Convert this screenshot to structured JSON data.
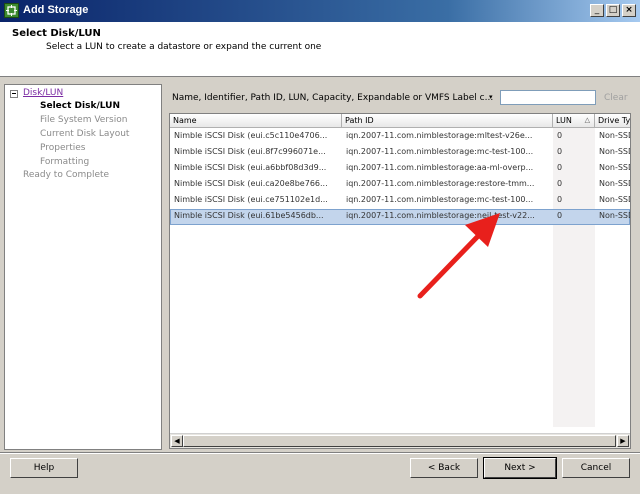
{
  "window": {
    "title": "Add Storage",
    "controls": {
      "minimize": "_",
      "maximize": "□",
      "close": "×"
    }
  },
  "header": {
    "title": "Select Disk/LUN",
    "subtitle": "Select a LUN to create a datastore or expand the current one"
  },
  "nav": {
    "root": "Disk/LUN",
    "items": [
      {
        "label": "Select Disk/LUN"
      },
      {
        "label": "File System Version"
      },
      {
        "label": "Current Disk Layout"
      },
      {
        "label": "Properties"
      },
      {
        "label": "Formatting"
      }
    ],
    "final": "Ready to Complete"
  },
  "filter": {
    "label": "Name, Identifier, Path ID, LUN, Capacity, Expandable or VMFS Label c...",
    "dropdown_arrow": "▾",
    "value": "",
    "clear_label": "Clear"
  },
  "table": {
    "columns": [
      "Name",
      "Path ID",
      "LUN",
      "Drive Ty"
    ],
    "sort_indicator": "△",
    "rows": [
      {
        "name": "Nimble iSCSI Disk (eui.c5c110e4706...",
        "path": "iqn.2007-11.com.nimblestorage:mltest-v26e...",
        "lun": "0",
        "drive": "Non-SSD"
      },
      {
        "name": "Nimble iSCSI Disk (eui.8f7c996071e...",
        "path": "iqn.2007-11.com.nimblestorage:mc-test-100...",
        "lun": "0",
        "drive": "Non-SSD"
      },
      {
        "name": "Nimble iSCSI Disk (eui.a6bbf08d3d9...",
        "path": "iqn.2007-11.com.nimblestorage:aa-ml-overp...",
        "lun": "0",
        "drive": "Non-SSD"
      },
      {
        "name": "Nimble iSCSI Disk (eui.ca20e8be766...",
        "path": "iqn.2007-11.com.nimblestorage:restore-tmm...",
        "lun": "0",
        "drive": "Non-SSD"
      },
      {
        "name": "Nimble iSCSI Disk (eui.ce751102e1d...",
        "path": "iqn.2007-11.com.nimblestorage:mc-test-100...",
        "lun": "0",
        "drive": "Non-SSD"
      },
      {
        "name": "Nimble iSCSI Disk (eui.61be5456db...",
        "path": "iqn.2007-11.com.nimblestorage:neil-test-v22...",
        "lun": "0",
        "drive": "Non-SSD"
      }
    ],
    "selected_index": 5
  },
  "scrollbar": {
    "left": "◀",
    "right": "▶"
  },
  "footer": {
    "help": {
      "label": "Help"
    },
    "back": {
      "label": "< Back"
    },
    "next": {
      "label": "Next >"
    },
    "cancel": {
      "label": "Cancel"
    }
  },
  "colors": {
    "annotation_arrow": "#e8201c",
    "selection": "#c3d5ec",
    "titlebar": "#0a246a"
  }
}
